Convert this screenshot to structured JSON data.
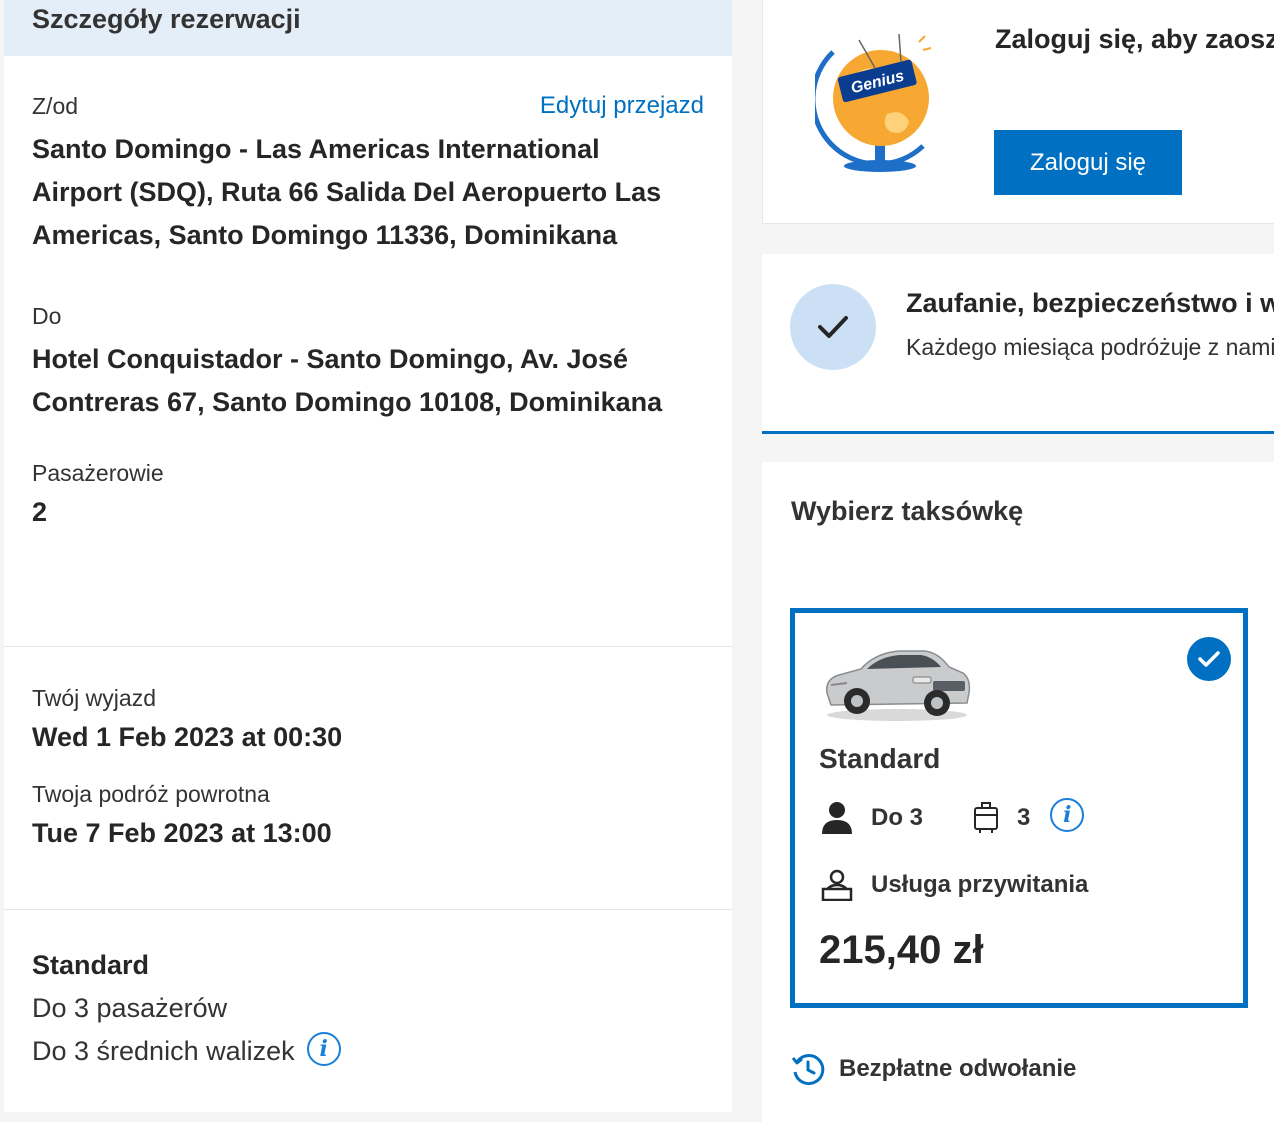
{
  "booking": {
    "header": "Szczegóły rezerwacji",
    "from_label": "Z/od",
    "edit_link": "Edytuj przejazd",
    "from_value": "Santo Domingo - Las Americas International Airport (SDQ), Ruta 66 Salida Del Aeropuerto Las Americas, Santo Domingo 11336, Dominikana",
    "to_label": "Do",
    "to_value": "Hotel Conquistador - Santo Domingo, Av. José Contreras 67, Santo Domingo 10108, Dominikana",
    "passengers_label": "Pasażerowie",
    "passengers_value": "2",
    "departure_label": "Twój wyjazd",
    "departure_value": "Wed 1 Feb 2023 at 00:30",
    "return_label": "Twoja podróż powrotna",
    "return_value": "Tue 7 Feb 2023 at 13:00",
    "vehicle_class": "Standard",
    "vehicle_passengers": "Do 3 pasażerów",
    "vehicle_luggage": "Do 3 średnich walizek"
  },
  "genius": {
    "badge_text": "Genius",
    "title": "Zaloguj się, aby zaoszczędzić na tej rezerwację",
    "login_button": "Zaloguj się"
  },
  "trust": {
    "title": "Zaufanie, bezpieczeństwo i wsparcie",
    "subtitle": "Każdego miesiąca podróżuje z nami"
  },
  "taxi": {
    "section_title": "Wybierz taksówkę",
    "name": "Standard",
    "passengers": "Do 3",
    "bags": "3",
    "meet_greet": "Usługa przywitania",
    "price": "215,40 zł",
    "selected": true,
    "free_cancellation": "Bezpłatne odwołanie"
  },
  "colors": {
    "accent": "#0071c2",
    "header_bg": "#e4eef8",
    "trust_circle": "#cce0f5"
  }
}
